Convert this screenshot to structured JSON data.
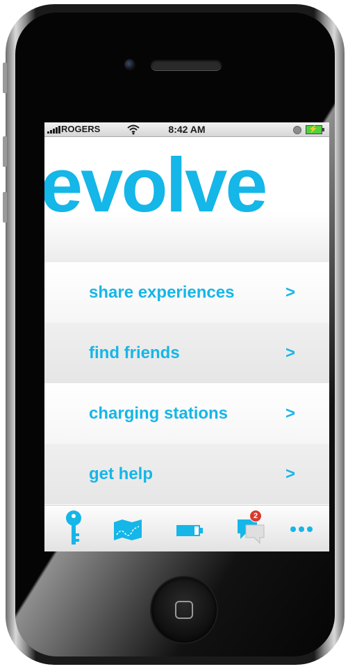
{
  "status_bar": {
    "carrier": "ROGERS",
    "time": "8:42 AM"
  },
  "app": {
    "logo": "evolve",
    "brand_color": "#15b6e8"
  },
  "menu": [
    {
      "label": "share experiences",
      "arrow": ">"
    },
    {
      "label": "find friends",
      "arrow": ">"
    },
    {
      "label": "charging stations",
      "arrow": ">"
    },
    {
      "label": "get help",
      "arrow": ">"
    }
  ],
  "tab_bar": {
    "tabs": [
      {
        "icon": "key-icon"
      },
      {
        "icon": "map-icon"
      },
      {
        "icon": "battery-icon"
      },
      {
        "icon": "chat-bubbles-icon",
        "badge": "2"
      },
      {
        "icon": "more-dots-icon"
      }
    ]
  }
}
